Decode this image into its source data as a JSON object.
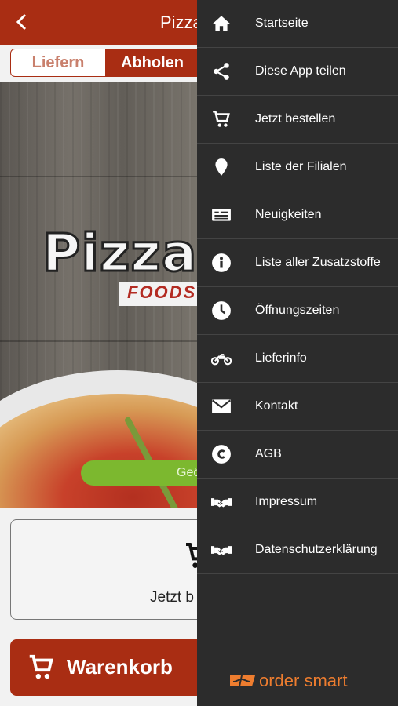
{
  "header": {
    "title": "Pizza"
  },
  "order_mode": {
    "deliver_label": "Liefern",
    "pickup_label": "Abholen",
    "selected": "Abholen"
  },
  "hero": {
    "logo_text": "Pizza",
    "logo_subtitle": "FOODS",
    "open_badge": "Geö"
  },
  "order_card": {
    "label": "Jetzt b"
  },
  "basket": {
    "label": "Warenkorb"
  },
  "drawer": {
    "items": [
      {
        "label": "Startseite",
        "icon": "home-icon"
      },
      {
        "label": "Diese App teilen",
        "icon": "share-icon"
      },
      {
        "label": "Jetzt bestellen",
        "icon": "cart-icon"
      },
      {
        "label": "Liste der Filialen",
        "icon": "location-pin-icon"
      },
      {
        "label": "Neuigkeiten",
        "icon": "newspaper-icon"
      },
      {
        "label": "Liste aller Zusatzstoffe",
        "icon": "info-icon"
      },
      {
        "label": "Öffnungszeiten",
        "icon": "clock-icon"
      },
      {
        "label": "Lieferinfo",
        "icon": "motorcycle-icon"
      },
      {
        "label": "Kontakt",
        "icon": "envelope-icon"
      },
      {
        "label": "AGB",
        "icon": "copyright-icon"
      },
      {
        "label": "Impressum",
        "icon": "handshake-icon"
      },
      {
        "label": "Datenschutzerklärung",
        "icon": "handshake-icon"
      }
    ],
    "footer_brand": "order smart"
  },
  "colors": {
    "brand_red": "#a92d13",
    "drawer_bg": "#2c2c2c",
    "accent_orange": "#ee7d2f",
    "open_green": "#7cb82f"
  }
}
